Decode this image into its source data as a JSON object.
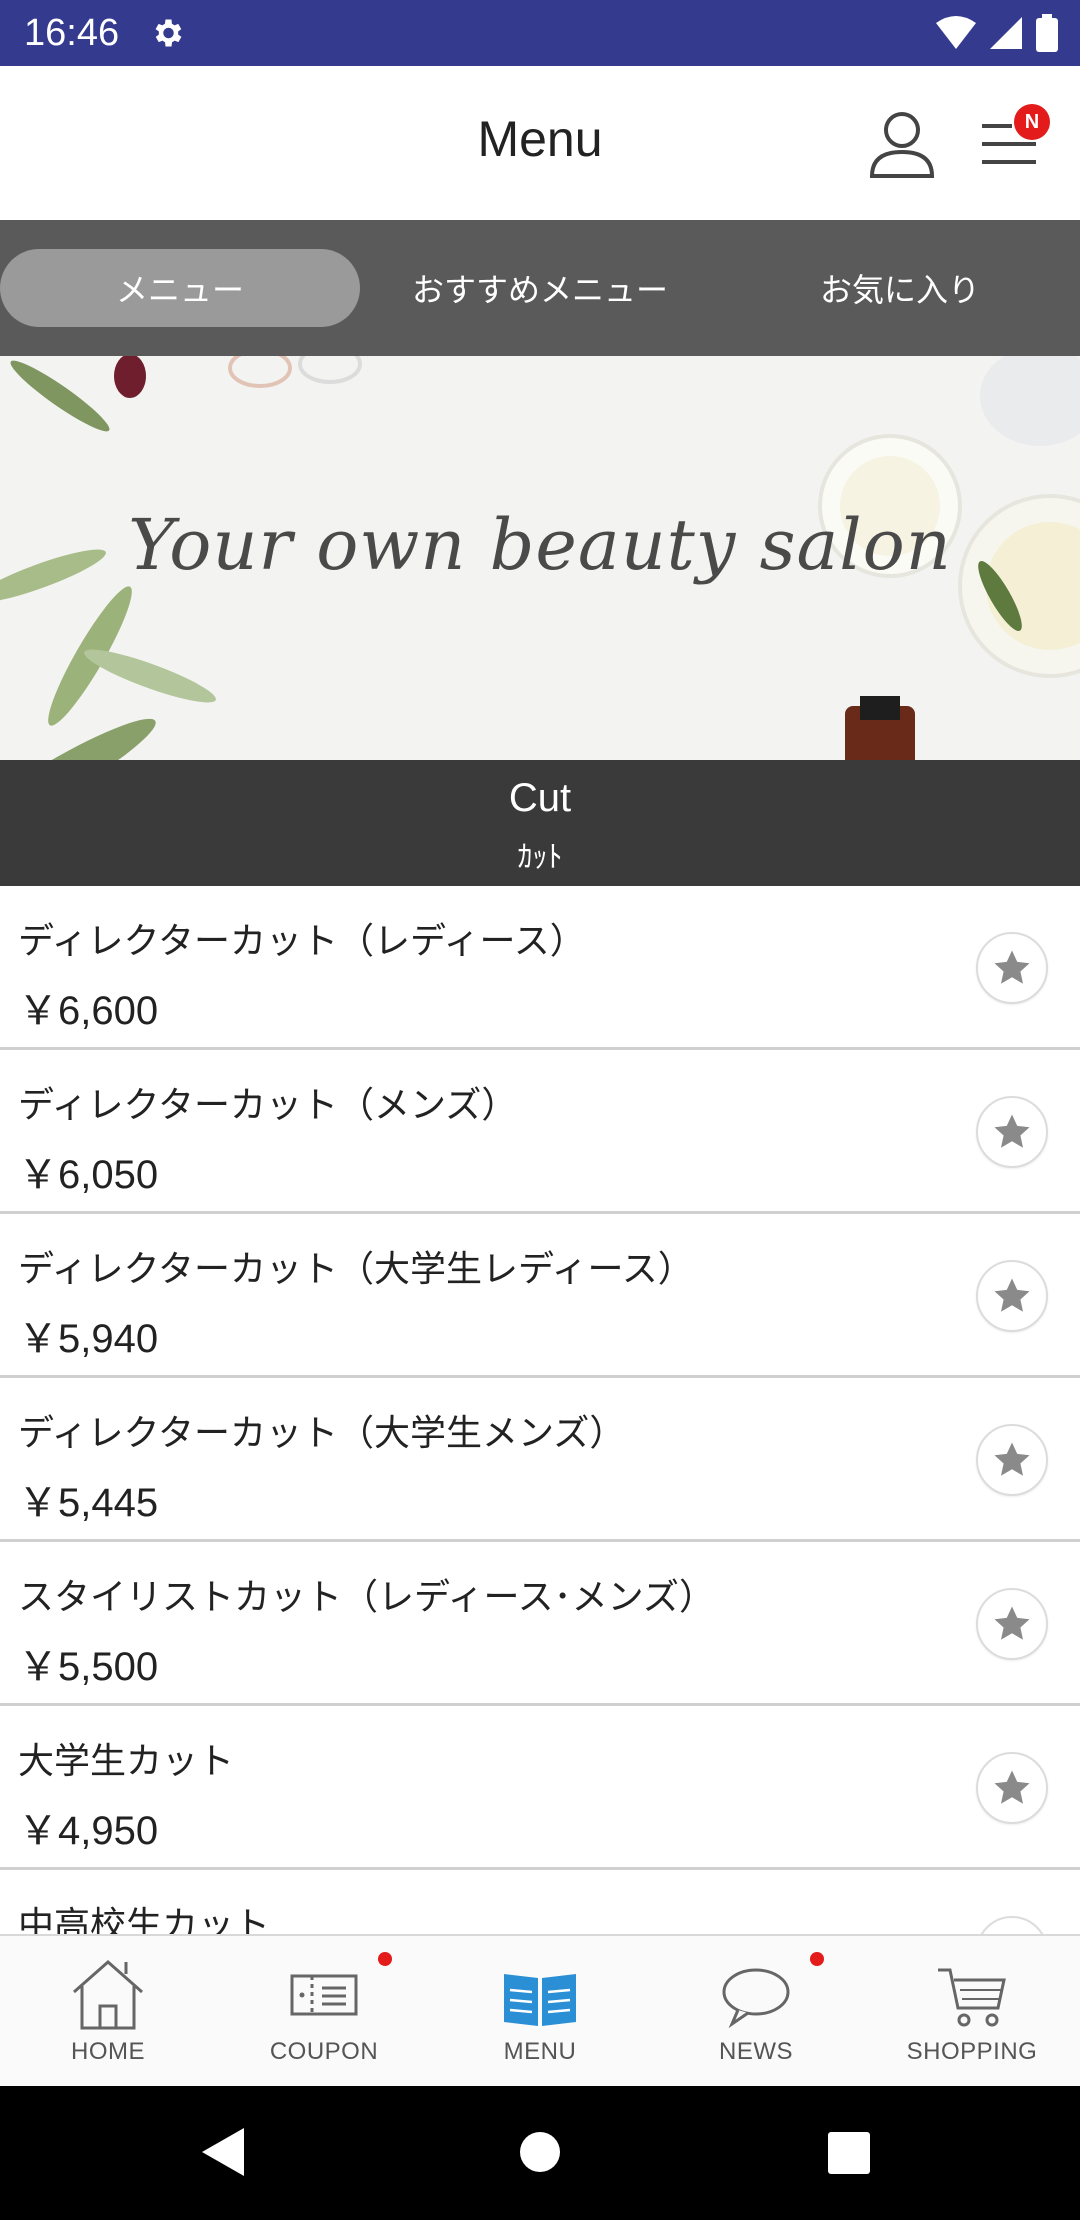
{
  "status_bar": {
    "time": "16:46",
    "bg_color": "#343a8e"
  },
  "header": {
    "title": "Menu",
    "notification_badge": "N"
  },
  "tabs": [
    {
      "label": "メニュー",
      "active": true
    },
    {
      "label": "おすすめメニュー",
      "active": false
    },
    {
      "label": "お気に入り",
      "active": false
    }
  ],
  "banner": {
    "text": "Your own beauty salon"
  },
  "category": {
    "name_en": "Cut",
    "name_jp": "ｶｯﾄ"
  },
  "menu_items": [
    {
      "name": "ディレクターカット（レディース）",
      "price": "￥6,600"
    },
    {
      "name": "ディレクターカット（メンズ）",
      "price": "￥6,050"
    },
    {
      "name": "ディレクターカット（大学生レディース）",
      "price": "￥5,940"
    },
    {
      "name": "ディレクターカット（大学生メンズ）",
      "price": "￥5,445"
    },
    {
      "name": "スタイリストカット（レディース･メンズ）",
      "price": "￥5,500"
    },
    {
      "name": "大学生カット",
      "price": "￥4,950"
    },
    {
      "name": "中高校生カット",
      "price": ""
    }
  ],
  "bottom_nav": [
    {
      "label": "HOME",
      "icon": "home-icon",
      "badge": false,
      "active": false
    },
    {
      "label": "COUPON",
      "icon": "coupon-icon",
      "badge": true,
      "active": false
    },
    {
      "label": "MENU",
      "icon": "menu-book-icon",
      "badge": false,
      "active": true
    },
    {
      "label": "NEWS",
      "icon": "news-bubble-icon",
      "badge": true,
      "active": false
    },
    {
      "label": "SHOPPING",
      "icon": "cart-icon",
      "badge": false,
      "active": false
    }
  ],
  "colors": {
    "accent": "#2b8fd6",
    "badge": "#e31b1b",
    "tab_bar": "#5a5a5a",
    "category_bar": "#3a3a3a"
  }
}
